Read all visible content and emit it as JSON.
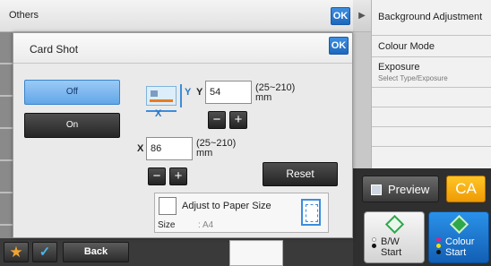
{
  "base": {
    "title": "Others",
    "ok_label": "OK",
    "back_label": "Back",
    "star_glyph": "★",
    "check_glyph": "✓"
  },
  "right_panel": {
    "arrow_glyph": "▶",
    "items": [
      {
        "label": "Background Adjustment"
      },
      {
        "label": "Colour Mode"
      },
      {
        "label": "Exposure",
        "sub": "Select Type/Exposure"
      }
    ],
    "preview_label": "Preview",
    "ca_label": "CA",
    "bw_start": {
      "line1": "B/W",
      "line2": "Start"
    },
    "colour_start": {
      "line1": "Colour",
      "line2": "Start"
    }
  },
  "dialog": {
    "title": "Card Shot",
    "ok_label": "OK",
    "off_label": "Off",
    "on_label": "On",
    "y_axis": "Y",
    "y_label": "Y",
    "y_value": "54",
    "y_range": "(25~210)",
    "y_unit": "mm",
    "x_axis": "X",
    "x_label": "X",
    "x_value": "86",
    "x_range": "(25~210)",
    "x_unit": "mm",
    "minus": "−",
    "plus": "+",
    "reset_label": "Reset",
    "adjust_label": "Adjust to Paper Size",
    "size_label": "Size",
    "size_value": ": A4"
  },
  "colors": {
    "accent_blue": "#1c68be",
    "toggle_selected": "#62a6e8",
    "ca_orange": "#ef9a05",
    "start_green": "#2ea84b",
    "dot_magenta": "#e0218a",
    "dot_yellow": "#f2e200",
    "dot_black": "#111111"
  }
}
